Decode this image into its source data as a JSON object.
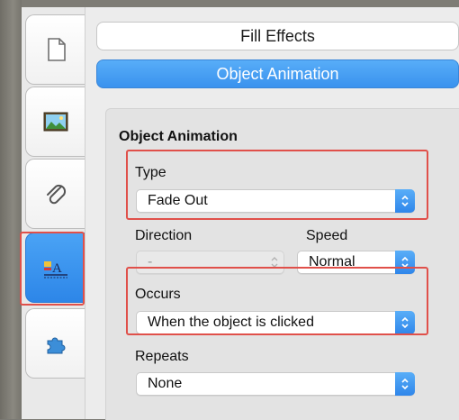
{
  "sidebar": {
    "items": [
      {
        "name": "document",
        "icon": "document-icon",
        "active": false
      },
      {
        "name": "image",
        "icon": "image-icon",
        "active": false
      },
      {
        "name": "attachment",
        "icon": "paperclip-icon",
        "active": false
      },
      {
        "name": "text-style",
        "icon": "text-style-icon",
        "active": true,
        "glyph": "A"
      },
      {
        "name": "plugin",
        "icon": "puzzle-icon",
        "active": false
      }
    ]
  },
  "tabs": {
    "fill_effects": "Fill Effects",
    "object_animation": "Object Animation"
  },
  "animation": {
    "section_title": "Object Animation",
    "type_label": "Type",
    "type_value": "Fade Out",
    "direction_label": "Direction",
    "direction_value": "-",
    "speed_label": "Speed",
    "speed_value": "Normal",
    "occurs_label": "Occurs",
    "occurs_value": "When the object is clicked",
    "repeats_label": "Repeats",
    "repeats_value": "None"
  },
  "colors": {
    "accent": "#3a92ee",
    "highlight_box": "#e0504a"
  }
}
